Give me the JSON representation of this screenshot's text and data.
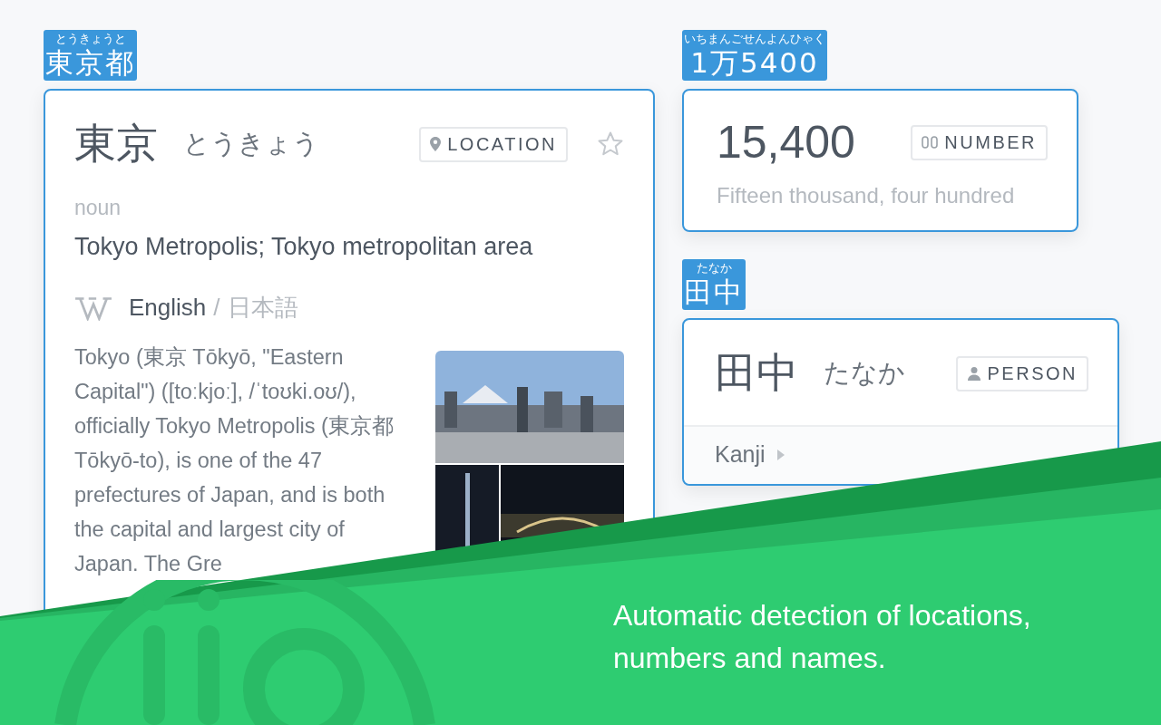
{
  "location_card": {
    "label": {
      "reading": "とうきょうと",
      "word": "東京都"
    },
    "word": "東京",
    "reading": "とうきょう",
    "tag": {
      "kind": "location",
      "text": "LOCATION"
    },
    "starred": false,
    "part_of_speech": "noun",
    "definition": "Tokyo Metropolis; Tokyo metropolitan area",
    "wiki": {
      "languages": [
        {
          "text": "English",
          "selected": true
        },
        {
          "text": "日本語",
          "selected": false
        }
      ],
      "separator": "/"
    },
    "extract": "Tokyo (東京 Tōkyō, \"Eastern Capital\") ([toːkjoː], /ˈtoʊki.oʊ/), officially Tokyo Metropolis (東京都 Tōkyō-to), is one of the 47 prefectures of Japan, and is both the capital and largest city of Japan. The Gre"
  },
  "number_card": {
    "label": {
      "reading": "いちまんごせんよんひゃく",
      "word": "1万5400"
    },
    "number": "15,400",
    "tag": {
      "kind": "number",
      "text": "NUMBER"
    },
    "words": "Fifteen thousand, four hundred"
  },
  "person_card": {
    "label": {
      "reading": "たなか",
      "word": "田中"
    },
    "word": "田中",
    "reading": "たなか",
    "tag": {
      "kind": "person",
      "text": "PERSON"
    },
    "sections": [
      {
        "text": "Kanji",
        "expanded": false
      }
    ]
  },
  "banner": {
    "text": "Automatic detection of locations, numbers and names."
  }
}
